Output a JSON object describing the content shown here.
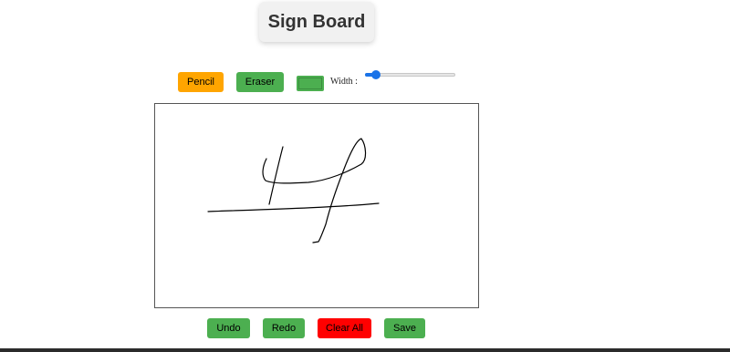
{
  "app": {
    "title": "Sign Board"
  },
  "toolbar": {
    "pencil_label": "Pencil",
    "eraser_label": "Eraser",
    "color_value": "#4CAF50",
    "width_label": "Width :",
    "width_fraction": 0.12
  },
  "actions": {
    "undo_label": "Undo",
    "redo_label": "Redo",
    "clear_label": "Clear All",
    "save_label": "Save"
  },
  "colors": {
    "pencil_active": "#FFA500",
    "green_button": "#4CAF50",
    "clear_button": "#FF0000",
    "accent": "#1A73E8",
    "ink": "#000000"
  }
}
